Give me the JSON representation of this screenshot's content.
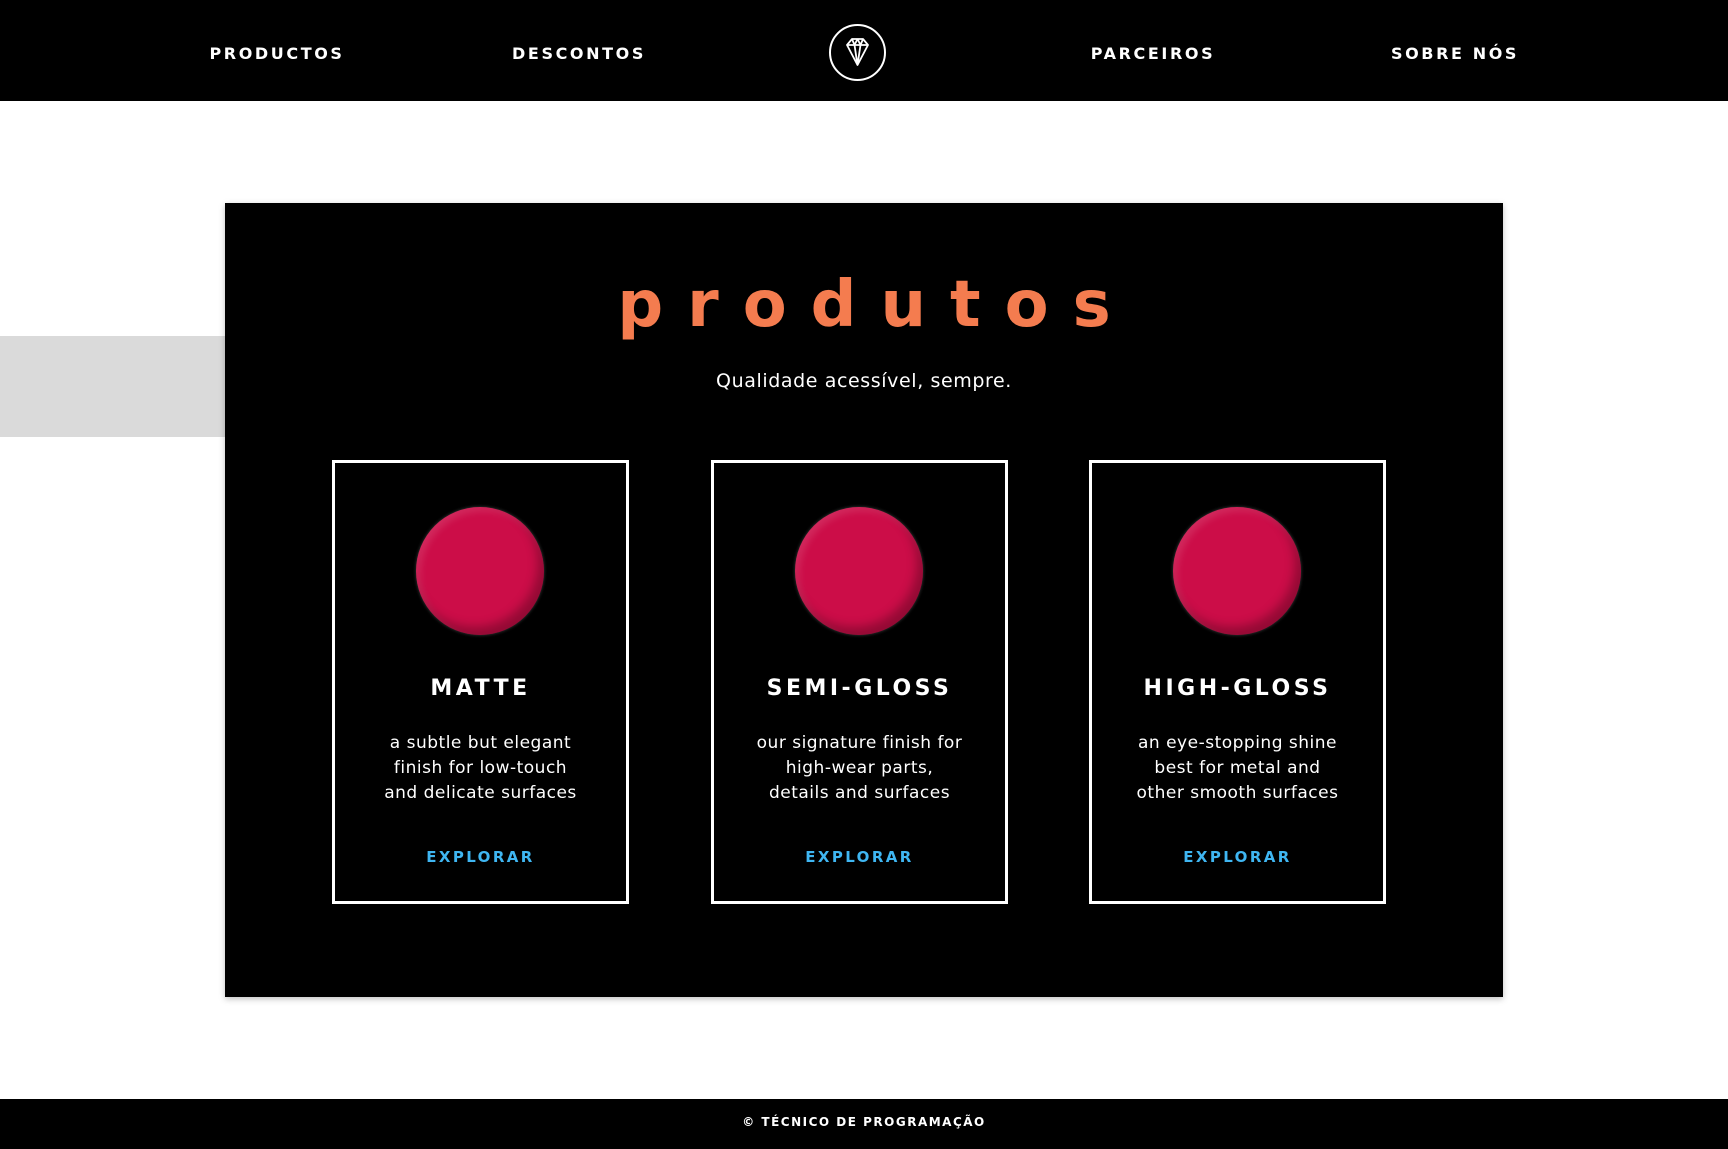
{
  "header": {
    "nav": [
      {
        "label": "PRODUCTOS"
      },
      {
        "label": "DESCONTOS"
      },
      {
        "label": "PARCEIROS"
      },
      {
        "label": "SOBRE NÓS"
      }
    ],
    "logo_icon": "diamond-icon"
  },
  "products": {
    "title": "produtos",
    "subtitle": "Qualidade acessível, sempre.",
    "cards": [
      {
        "name": "MATTE",
        "description": "a subtle but elegant\nfinish for low-touch\nand delicate surfaces",
        "link": "EXPLORAR"
      },
      {
        "name": "SEMI-GLOSS",
        "description": "our signature finish for\nhigh-wear parts,\ndetails and surfaces",
        "link": "EXPLORAR"
      },
      {
        "name": "HIGH-GLOSS",
        "description": "an eye-stopping shine\nbest for metal and\nother smooth surfaces",
        "link": "EXPLORAR"
      }
    ]
  },
  "footer": {
    "copyright": "© TÉCNICO DE PROGRAMAÇÃO"
  },
  "colors": {
    "background": "#ffffff",
    "header_bg": "#000000",
    "title_accent": "#f47c4f",
    "swatch": "#cc0d48",
    "link": "#3fb6f2",
    "side_block": "#dadada"
  }
}
